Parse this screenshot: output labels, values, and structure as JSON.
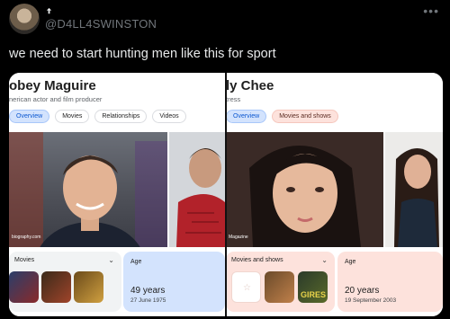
{
  "tweet": {
    "avatar_icon": "profile-avatar-icon",
    "badge_icon": "verified-badge-icon",
    "handle": "@D4LL4SWINSTON",
    "more_label": "•••",
    "text": "we need to start hunting men like this for sport"
  },
  "left_panel": {
    "title": "obey Maguire",
    "subtitle": "nerican actor and film producer",
    "tabs": [
      "Overview",
      "Movies",
      "Relationships",
      "Videos"
    ],
    "active_tab": "Overview",
    "photo_credit": "biography.com",
    "movies_label": "Movies",
    "age_label": "Age",
    "age_value": "49 years",
    "birth_date": "27 June 1975",
    "accent_color": "#d3e3fd"
  },
  "right_panel": {
    "title": "ly Chee",
    "subtitle": "tress",
    "tabs": [
      "Overview",
      "Movies and shows"
    ],
    "active_tab": "Overview",
    "photo_credit": "Magazine",
    "movies_label": "Movies and shows",
    "thumb_title": "GIRES",
    "age_label": "Age",
    "age_value": "20 years",
    "birth_date": "19 September 2003",
    "accent_color": "#fde2dc"
  }
}
